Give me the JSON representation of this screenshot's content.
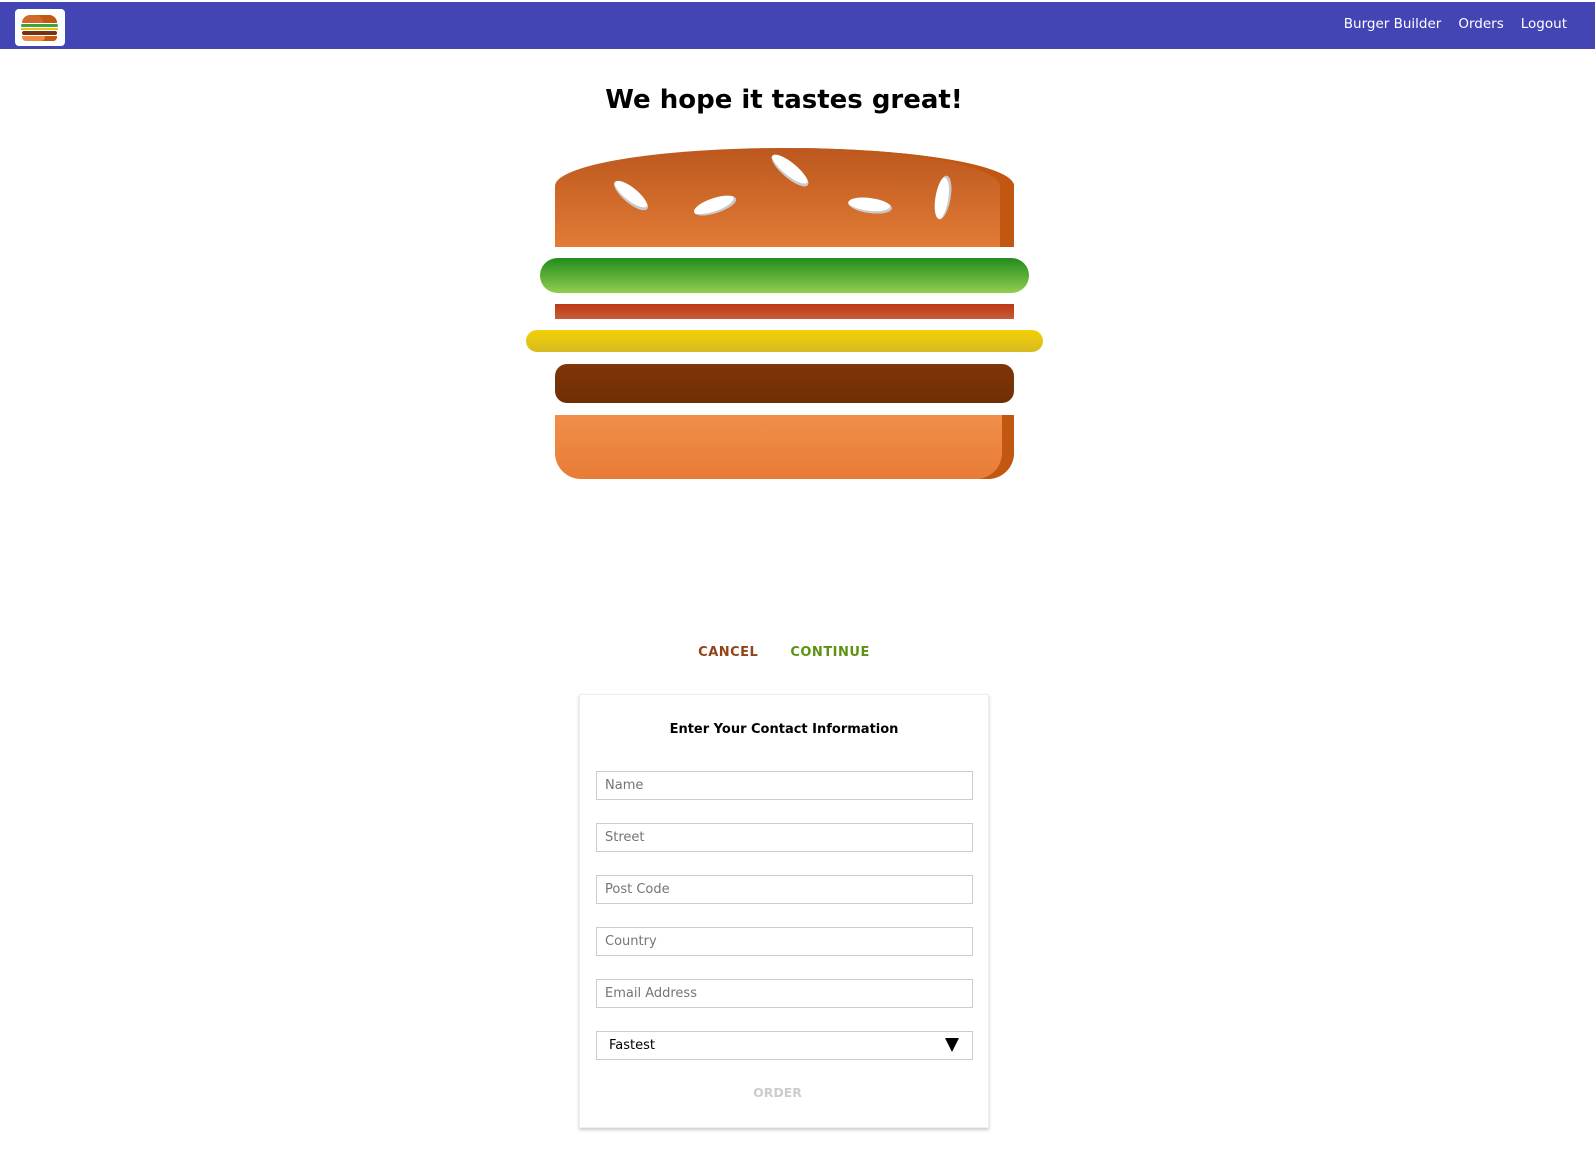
{
  "nav": {
    "links": [
      "Burger Builder",
      "Orders",
      "Logout"
    ]
  },
  "page": {
    "title": "We hope it tastes great!"
  },
  "burger": {
    "ingredients": [
      "bread-top",
      "salad",
      "bacon",
      "cheese",
      "meat",
      "bread-bottom"
    ],
    "colors": {
      "toolbar": "#4345b5",
      "bun": "#e27b36",
      "salad": "#228c1d",
      "bacon": "#bf3813",
      "cheese": "#f4d004",
      "meat": "#7f3608"
    }
  },
  "actions": {
    "cancel_label": "CANCEL",
    "continue_label": "CONTINUE"
  },
  "contact_form": {
    "heading": "Enter Your Contact Information",
    "fields": [
      {
        "name": "name",
        "placeholder": "Name",
        "value": ""
      },
      {
        "name": "street",
        "placeholder": "Street",
        "value": ""
      },
      {
        "name": "post-code",
        "placeholder": "Post Code",
        "value": ""
      },
      {
        "name": "country",
        "placeholder": "Country",
        "value": ""
      },
      {
        "name": "email",
        "placeholder": "Email Address",
        "value": ""
      }
    ],
    "delivery_method": {
      "selected": "Fastest"
    },
    "order_label": "ORDER"
  }
}
